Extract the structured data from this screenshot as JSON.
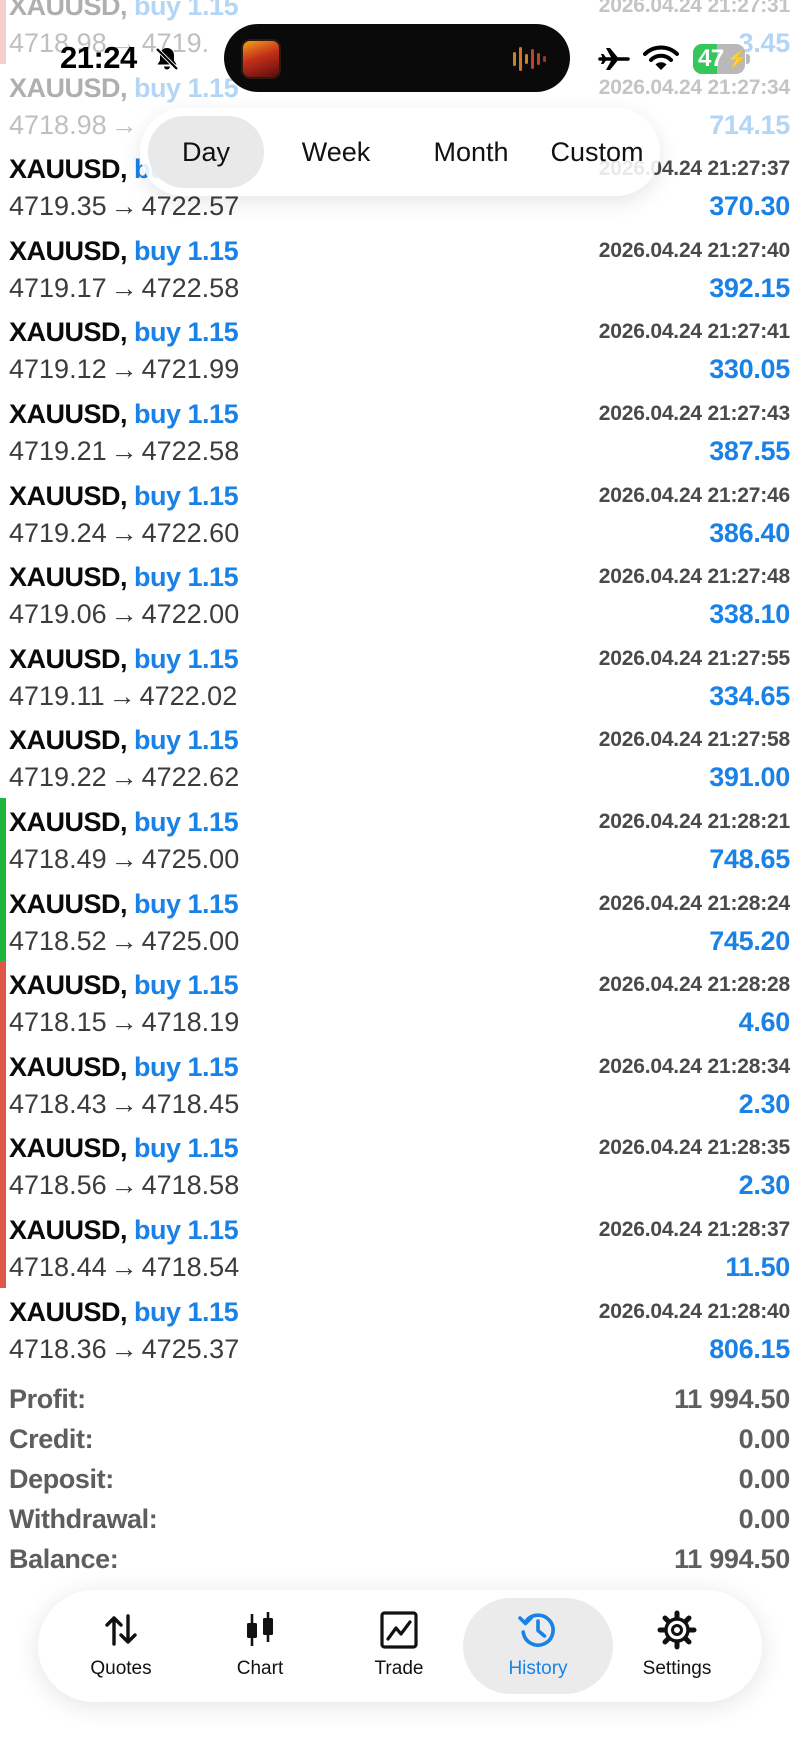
{
  "status_bar": {
    "time": "21:24",
    "battery": "47",
    "battery_level": 0.47
  },
  "period_tabs": [
    {
      "label": "Day",
      "active": true
    },
    {
      "label": "Week",
      "active": false
    },
    {
      "label": "Month",
      "active": false
    },
    {
      "label": "Custom",
      "active": false
    }
  ],
  "trades": [
    {
      "symbol": "XAUUSD,",
      "side": "buy 1.15",
      "open": "4718.98",
      "close": "4719.",
      "time": "2026.04.24 21:27:31",
      "profit": "3.45",
      "indicator": "#e26a5a",
      "faded": true
    },
    {
      "symbol": "XAUUSD,",
      "side": "buy 1.15",
      "open": "4718.98",
      "close": "",
      "time": "2026.04.24 21:27:34",
      "profit": "714.15",
      "indicator": "",
      "faded": true
    },
    {
      "symbol": "XAUUSD,",
      "side": "buy 1.15",
      "open": "4719.35",
      "close": "4722.57",
      "time": "2026.04.24 21:27:37",
      "profit": "370.30",
      "indicator": "",
      "faded": false
    },
    {
      "symbol": "XAUUSD,",
      "side": "buy 1.15",
      "open": "4719.17",
      "close": "4722.58",
      "time": "2026.04.24 21:27:40",
      "profit": "392.15",
      "indicator": "",
      "faded": false
    },
    {
      "symbol": "XAUUSD,",
      "side": "buy 1.15",
      "open": "4719.12",
      "close": "4721.99",
      "time": "2026.04.24 21:27:41",
      "profit": "330.05",
      "indicator": "",
      "faded": false
    },
    {
      "symbol": "XAUUSD,",
      "side": "buy 1.15",
      "open": "4719.21",
      "close": "4722.58",
      "time": "2026.04.24 21:27:43",
      "profit": "387.55",
      "indicator": "",
      "faded": false
    },
    {
      "symbol": "XAUUSD,",
      "side": "buy 1.15",
      "open": "4719.24",
      "close": "4722.60",
      "time": "2026.04.24 21:27:46",
      "profit": "386.40",
      "indicator": "",
      "faded": false
    },
    {
      "symbol": "XAUUSD,",
      "side": "buy 1.15",
      "open": "4719.06",
      "close": "4722.00",
      "time": "2026.04.24 21:27:48",
      "profit": "338.10",
      "indicator": "",
      "faded": false
    },
    {
      "symbol": "XAUUSD,",
      "side": "buy 1.15",
      "open": "4719.11",
      "close": "4722.02",
      "time": "2026.04.24 21:27:55",
      "profit": "334.65",
      "indicator": "",
      "faded": false
    },
    {
      "symbol": "XAUUSD,",
      "side": "buy 1.15",
      "open": "4719.22",
      "close": "4722.62",
      "time": "2026.04.24 21:27:58",
      "profit": "391.00",
      "indicator": "",
      "faded": false
    },
    {
      "symbol": "XAUUSD,",
      "side": "buy 1.15",
      "open": "4718.49",
      "close": "4725.00",
      "time": "2026.04.24 21:28:21",
      "profit": "748.65",
      "indicator": "#1fb53a",
      "faded": false
    },
    {
      "symbol": "XAUUSD,",
      "side": "buy 1.15",
      "open": "4718.52",
      "close": "4725.00",
      "time": "2026.04.24 21:28:24",
      "profit": "745.20",
      "indicator": "#1fb53a",
      "faded": false
    },
    {
      "symbol": "XAUUSD,",
      "side": "buy 1.15",
      "open": "4718.15",
      "close": "4718.19",
      "time": "2026.04.24 21:28:28",
      "profit": "4.60",
      "indicator": "#e0574a",
      "faded": false
    },
    {
      "symbol": "XAUUSD,",
      "side": "buy 1.15",
      "open": "4718.43",
      "close": "4718.45",
      "time": "2026.04.24 21:28:34",
      "profit": "2.30",
      "indicator": "#e0574a",
      "faded": false
    },
    {
      "symbol": "XAUUSD,",
      "side": "buy 1.15",
      "open": "4718.56",
      "close": "4718.58",
      "time": "2026.04.24 21:28:35",
      "profit": "2.30",
      "indicator": "#e0574a",
      "faded": false
    },
    {
      "symbol": "XAUUSD,",
      "side": "buy 1.15",
      "open": "4718.44",
      "close": "4718.54",
      "time": "2026.04.24 21:28:37",
      "profit": "11.50",
      "indicator": "#e0574a",
      "faded": false
    },
    {
      "symbol": "XAUUSD,",
      "side": "buy 1.15",
      "open": "4718.36",
      "close": "4725.37",
      "time": "2026.04.24 21:28:40",
      "profit": "806.15",
      "indicator": "",
      "faded": false
    }
  ],
  "summary": [
    {
      "label": "Profit:",
      "value": "11 994.50"
    },
    {
      "label": "Credit:",
      "value": "0.00"
    },
    {
      "label": "Deposit:",
      "value": "0.00"
    },
    {
      "label": "Withdrawal:",
      "value": "0.00"
    },
    {
      "label": "Balance:",
      "value": "11 994.50"
    }
  ],
  "tabs": [
    {
      "label": "Quotes",
      "icon": "quotes-arrows-icon",
      "active": false
    },
    {
      "label": "Chart",
      "icon": "candlestick-icon",
      "active": false
    },
    {
      "label": "Trade",
      "icon": "trade-chart-icon",
      "active": false
    },
    {
      "label": "History",
      "icon": "history-clock-icon",
      "active": true
    },
    {
      "label": "Settings",
      "icon": "gear-icon",
      "active": false
    }
  ],
  "colors": {
    "accent": "#1a82e6",
    "profit_positive": "#1fb53a",
    "loss_marker": "#e0574a"
  }
}
